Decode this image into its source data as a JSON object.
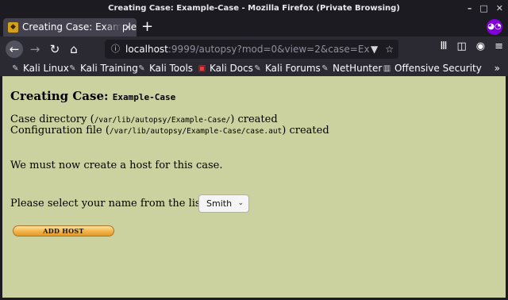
{
  "window": {
    "title": "Creating Case: Example-Case - Mozilla Firefox (Private Browsing)",
    "min": "–",
    "max": "□",
    "close": "✕"
  },
  "tab": {
    "label": "Creating Case: Example-Case",
    "close": "✕",
    "new_tab": "+"
  },
  "nav": {
    "back": "←",
    "forward": "→",
    "reload": "↻",
    "home": "⌂",
    "url_host": "localhost",
    "url_rest": ":9999/autopsy?mod=0&view=2&case=E",
    "url_more": "x",
    "info": "ⓘ",
    "pocket": "▼",
    "star": "☆"
  },
  "toolbar_icons": {
    "library": "Ⅲ",
    "sidebar": "◫",
    "account": "◉",
    "menu": "≡"
  },
  "bookmarks": [
    {
      "label": "Kali Linux",
      "icon": "✎"
    },
    {
      "label": "Kali Training",
      "icon": "✎"
    },
    {
      "label": "Kali Tools",
      "icon": "✎"
    },
    {
      "label": "Kali Docs",
      "icon": "▣"
    },
    {
      "label": "Kali Forums",
      "icon": "✎"
    },
    {
      "label": "NetHunter",
      "icon": "✎"
    },
    {
      "label": "Offensive Security",
      "icon": "▥"
    }
  ],
  "bookmarks_more": "»",
  "page": {
    "heading_prefix": "Creating Case:",
    "case_name": "Example-Case",
    "dir_prefix": "Case directory (",
    "dir_path": "/var/lib/autopsy/Example-Case/",
    "dir_suffix": ") created",
    "cfg_prefix": "Configuration file (",
    "cfg_path": "/var/lib/autopsy/Example-Case/case.aut",
    "cfg_suffix": ") created",
    "host_msg": "We must now create a host for this case.",
    "select_label": "Please select your name from the list:",
    "selected_name": "Smith",
    "select_arrow": "⌄",
    "add_host_button": "ADD HOST"
  },
  "colors": {
    "page_bg": "#ccd29f",
    "chrome_bg": "#2b2a33",
    "private_purple": "#8000d7"
  }
}
